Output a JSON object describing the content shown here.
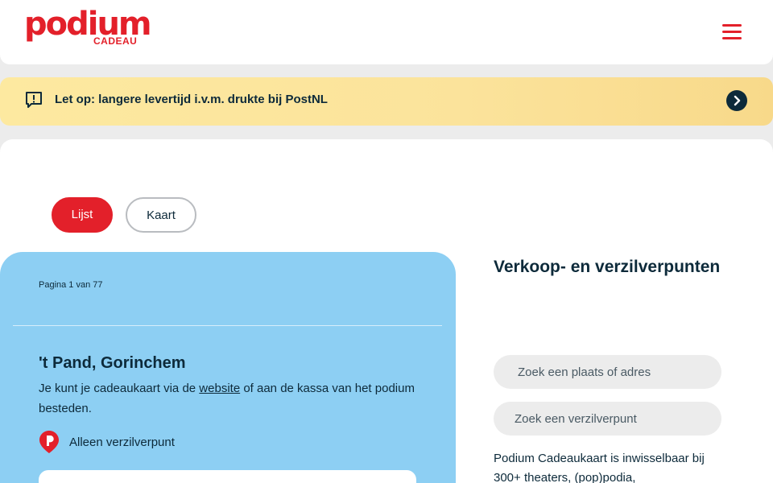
{
  "header": {
    "logo_text": "podium",
    "logo_sub": "CADEAU",
    "brand_color": "#e3202a",
    "menu_icon": "hamburger-menu-icon"
  },
  "notice": {
    "icon": "message-alert-icon",
    "text": "Let op: langere levertijd i.v.m. drukte bij PostNL",
    "arrow_icon": "chevron-right-circle-icon",
    "background": "#fbe39b"
  },
  "view_toggle": {
    "list_label": "Lijst",
    "map_label": "Kaart",
    "active": "Lijst"
  },
  "results": {
    "pagination": "Pagina 1 van 77",
    "background": "#8dcff3",
    "items": [
      {
        "title": "'t Pand, Gorinchem",
        "desc_before": "Je kunt je cadeaukaart via de ",
        "link_text": "website",
        "desc_after": " of aan de kassa van het podium besteden.",
        "type_icon": "podium-location-pin-icon",
        "type_label": "Alleen verzilverpunt"
      }
    ]
  },
  "sidebar": {
    "title": "Verkoop- en verzilverpunten",
    "search_place_placeholder": "Zoek een plaats of adres",
    "search_point_placeholder": "Zoek een verzilverpunt",
    "intro_text": "Podium Cadeaukaart is inwisselbaar bij 300+ theaters, (pop)podia,"
  }
}
